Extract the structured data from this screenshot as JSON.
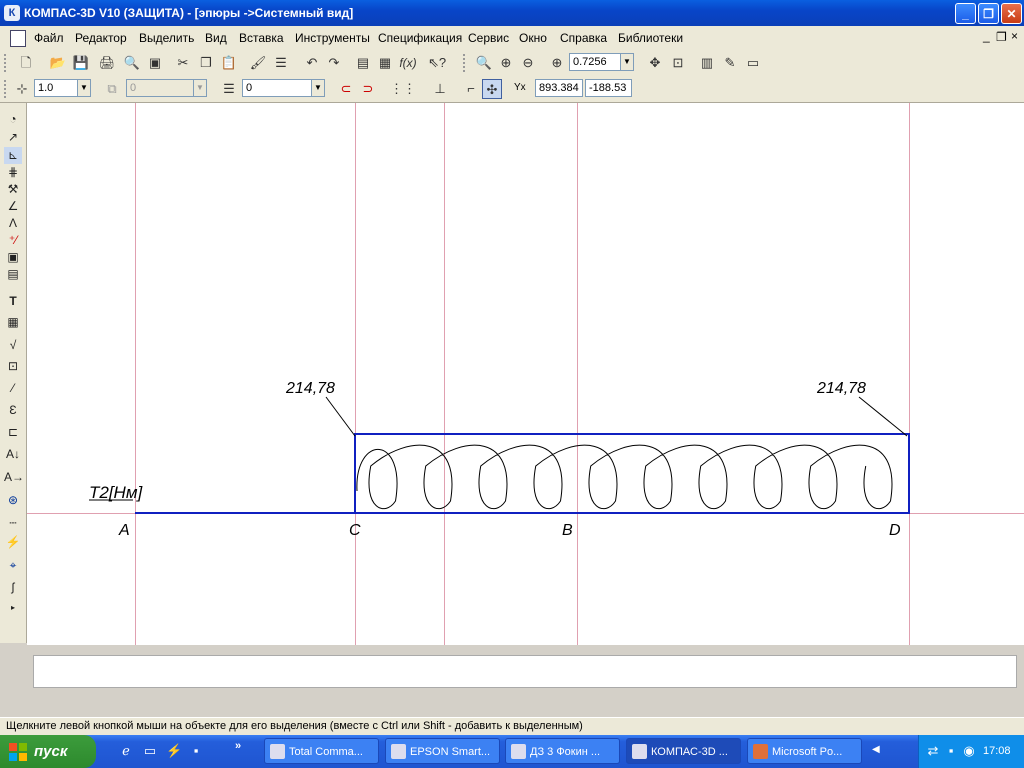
{
  "window": {
    "title": "КОМПАС-3D V10 (ЗАЩИТА) - [эпюры ->Системный вид]",
    "app_icon_letter": "К",
    "buttons": {
      "minimize": "_",
      "maximize": "❐",
      "close": "✕"
    }
  },
  "menu": {
    "items": [
      "Файл",
      "Редактор",
      "Выделить",
      "Вид",
      "Вставка",
      "Инструменты",
      "Спецификация",
      "Сервис",
      "Окно",
      "Справка",
      "Библиотеки"
    ],
    "doc_controls": [
      "_",
      "❐",
      "×"
    ]
  },
  "toolbar_standard": {
    "zoom_value": "0.7256"
  },
  "toolbar_current_state": {
    "step_value": "1.0",
    "layer_field": "0",
    "style_field": "0",
    "coord_label": "Yx",
    "coord_x": "893.384",
    "coord_y": "-188.53"
  },
  "drawing": {
    "y_axis_label": "T2[Нм]",
    "points": [
      "A",
      "C",
      "B",
      "D"
    ],
    "value_left": "214,78",
    "value_right": "214,78"
  },
  "status": {
    "text": "Щелкните левой кнопкой мыши на объекте для его выделения (вместе с Ctrl или Shift - добавить к выделенным)"
  },
  "taskbar": {
    "start_label": "пуск",
    "chevron": "»",
    "tasks": [
      {
        "label": "Total Comma..."
      },
      {
        "label": "EPSON Smart..."
      },
      {
        "label": "ДЗ 3 Фокин ..."
      },
      {
        "label": "КОМПАС-3D ..."
      },
      {
        "label": "Microsoft Po..."
      }
    ],
    "clock": "17:08"
  },
  "colors": {
    "diagram_blue": "#1020c0",
    "guide_line": "#e0a0b0",
    "titlebar": "#0a5fe0"
  }
}
